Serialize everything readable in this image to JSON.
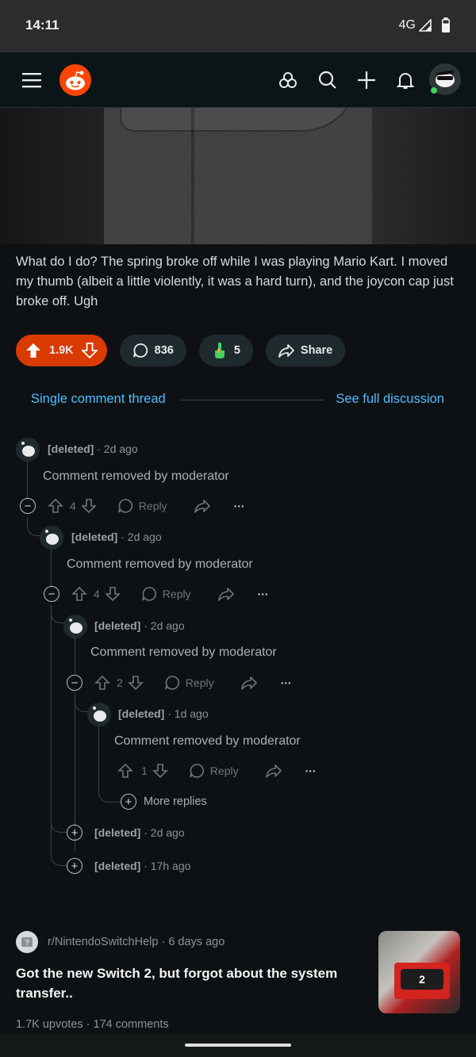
{
  "status_bar": {
    "time": "14:11",
    "network": "4G"
  },
  "post": {
    "body": "What do I do? The spring broke off while I was playing Mario Kart. I moved my thumb (albeit a little violently, it was a hard turn), and the joycon cap just broke off. Ugh",
    "votes": "1.9K",
    "comments": "836",
    "awards": "5",
    "share_label": "Share"
  },
  "thread_nav": {
    "single": "Single comment thread",
    "full": "See full discussion"
  },
  "comments": [
    {
      "user": "[deleted]",
      "age": "2d ago",
      "text": "Comment removed by moderator",
      "score": "4",
      "reply": "Reply"
    },
    {
      "user": "[deleted]",
      "age": "2d ago",
      "text": "Comment removed by moderator",
      "score": "4",
      "reply": "Reply"
    },
    {
      "user": "[deleted]",
      "age": "2d ago",
      "text": "Comment removed by moderator",
      "score": "2",
      "reply": "Reply"
    },
    {
      "user": "[deleted]",
      "age": "1d ago",
      "text": "Comment removed by moderator",
      "score": "1",
      "reply": "Reply"
    }
  ],
  "more_replies": "More replies",
  "collapsed": [
    {
      "user": "[deleted]",
      "age": "2d ago"
    },
    {
      "user": "[deleted]",
      "age": "17h ago"
    }
  ],
  "recommended": {
    "subreddit": "r/NintendoSwitchHelp",
    "age": "6 days ago",
    "title": "Got the new Switch 2, but forgot about the system transfer..",
    "upvotes": "1.7K upvotes",
    "comments": "174 comments",
    "thumb_text": "2"
  },
  "colors": {
    "accent": "#d93a00",
    "link": "#4fbcff",
    "bg": "#0e1113"
  }
}
